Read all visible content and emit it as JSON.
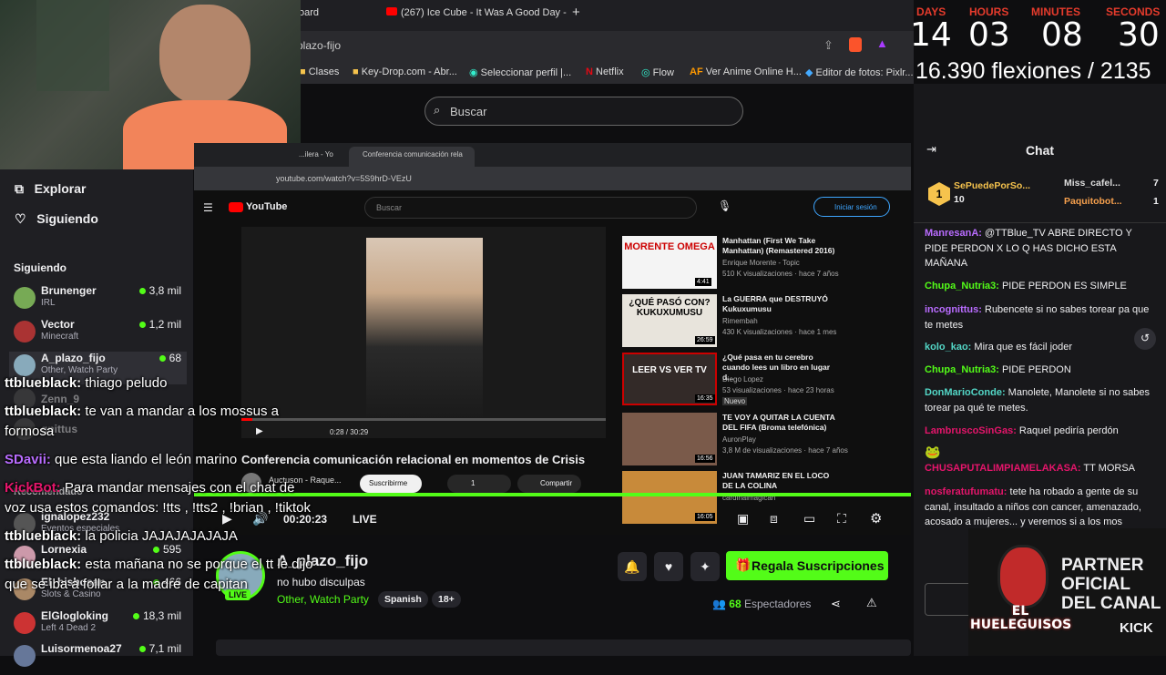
{
  "browser": {
    "tabs": [
      {
        "label": "oard"
      },
      {
        "label": "(267) Ice Cube - It Was A Good Day -"
      }
    ],
    "new_tab": "+",
    "url": "plazo-fijo",
    "bookmarks": [
      {
        "label": "Clases"
      },
      {
        "label": "Key-Drop.com - Abr..."
      },
      {
        "label": "Seleccionar perfil |..."
      },
      {
        "label": "Netflix"
      },
      {
        "label": "Flow"
      },
      {
        "label": "Ver Anime Online H..."
      },
      {
        "label": "Editor de fotos: Pixlr..."
      }
    ]
  },
  "search": {
    "placeholder": "Buscar"
  },
  "timer": {
    "labels": {
      "days": "DAYS",
      "hours": "HOURS",
      "minutes": "MINUTES",
      "seconds": "SECONDS"
    },
    "values": {
      "days": "14",
      "hours": "03",
      "minutes": "08",
      "seconds": "30"
    },
    "pushups": "16.390 flexiones / 2135"
  },
  "sidebar": {
    "explore": "Explorar",
    "following": "Siguiendo",
    "section": "Siguiendo",
    "recommended": "Recomendado",
    "channels": [
      {
        "name": "Brunenger",
        "category": "IRL",
        "viewers": "3,8 mil"
      },
      {
        "name": "Vector",
        "category": "Minecraft",
        "viewers": "1,2 mil"
      },
      {
        "name": "A_plazo_fijo",
        "category": "Other, Watch Party",
        "viewers": "68"
      },
      {
        "name": "Zenn_9",
        "category": "",
        "viewers": ""
      },
      {
        "name": "gnittus",
        "category": "",
        "viewers": ""
      }
    ],
    "rec_channels": [
      {
        "name": "ignalopez232",
        "category": "Eventos especiales",
        "viewers": ""
      },
      {
        "name": "Lornexia",
        "category": "",
        "viewers": "595"
      },
      {
        "name": "El_bishosan",
        "category": "Slots & Casino",
        "viewers": "466"
      },
      {
        "name": "ElGlogloking",
        "category": "Left 4 Dead 2",
        "viewers": "18,3 mil"
      },
      {
        "name": "Luisormenoa27",
        "category": "",
        "viewers": "7,1 mil"
      }
    ]
  },
  "youtube": {
    "tabs": [
      "...ilera - Yo",
      "Conferencia comunicación rela"
    ],
    "url": "youtube.com/watch?v=5S9hrD-VEzU",
    "logo": "YouTube",
    "search_placeholder": "Buscar",
    "signin": "Iniciar sesión",
    "time": "0:28 / 30:29",
    "video_title": "Conferencia comunicación relacional en momentos de Crisis",
    "channel": "Auctuson - Raque...",
    "subscribe": "Suscribirme",
    "likes": "1",
    "share": "Compartir",
    "recommendations": [
      {
        "title": "Manhattan (First We Take Manhattan) (Remastered 2016)",
        "channel": "Enrique Morente - Topic",
        "meta": "510 K visualizaciones · hace 7 años",
        "duration": "4:41",
        "thumb": "MORENTE OMEGA"
      },
      {
        "title": "La GUERRA que DESTRUYÓ Kukuxumusu",
        "channel": "Rimembah",
        "meta": "430 K visualizaciones · hace 1 mes",
        "duration": "26:59",
        "thumb": "¿QUÉ PASÓ CON? KUKUXUMUSU"
      },
      {
        "title": "¿Qué pasa en tu cerebro cuando lees un libro en lugar d...",
        "channel": "Diego Lopez",
        "meta": "53 visualizaciones · hace 23 horas",
        "duration": "16:35",
        "thumb": "LEER VS VER TV",
        "badge": "Nuevo"
      },
      {
        "title": "TE VOY A QUITAR LA CUENTA DEL FIFA (Broma telefónica)",
        "channel": "AuronPlay",
        "meta": "3,8 M de visualizaciones · hace 7 años",
        "duration": "16:56",
        "thumb": ""
      },
      {
        "title": "JUAN TAMARIZ EN EL LOCO DE LA COLINA",
        "channel": "cardinalmagican",
        "meta": "",
        "duration": "16:05",
        "thumb": ""
      }
    ]
  },
  "player": {
    "time": "00:20:23",
    "live": "LIVE"
  },
  "stream": {
    "name": "A_plazo_fijo",
    "title": "no hubo disculpas",
    "category": "Other, Watch Party",
    "tags": [
      "Spanish",
      "18+"
    ],
    "live_badge": "LIVE",
    "gift": "Regala Suscripciones",
    "viewers": "68",
    "viewers_label": "Espectadores"
  },
  "chat": {
    "title": "Chat",
    "leaderboard": [
      {
        "name": "SePuedePorSo...",
        "value": "10"
      },
      {
        "name": "Miss_cafel...",
        "value": "7"
      },
      {
        "name": "Paquitobot...",
        "value": "1"
      }
    ],
    "messages": [
      {
        "user": "ManresanA:",
        "text": "@TTBlue_TV ABRE DIRECTO Y PIDE PERDON X LO Q HAS DICHO ESTA MAÑANA",
        "color": "#b96cff"
      },
      {
        "user": "Chupa_Nutria3:",
        "text": "PIDE PERDON ES SIMPLE",
        "color": "#53fc18"
      },
      {
        "user": "incognittus:",
        "text": "Rubencete si no sabes torear pa que te metes",
        "color": "#b96cff"
      },
      {
        "user": "kolo_kao:",
        "text": "Mira que es fácil joder",
        "color": "#53d6c6"
      },
      {
        "user": "Chupa_Nutria3:",
        "text": "PIDE PERDON",
        "color": "#53fc18"
      },
      {
        "user": "DonMarioConde:",
        "text": "Manolete, Manolete si no sabes torear pa qué te metes.",
        "color": "#53d6c6"
      },
      {
        "user": "LambruscoSinGas:",
        "text": "Raquel pediría perdón",
        "color": "#e5156b"
      },
      {
        "user": "CHUSAPUTALIMPIAMELAKASA:",
        "text": "TT MORSA",
        "color": "#e5156b"
      },
      {
        "user": "nosferatufumatu:",
        "text": "tete ha robado a gente de su canal, insultado a niños con cancer, amenazado, acosado a mujeres... y veremos si a los mos",
        "color": "#e5156b"
      }
    ]
  },
  "overlay_chat": [
    {
      "user": "ttblueblack:",
      "text": "thiago peludo"
    },
    {
      "user": "ttblueblack:",
      "text": "te van a mandar a los mossus a"
    },
    {
      "user": "",
      "text": "formosa"
    },
    {
      "user": "SDavii:",
      "text": "que esta liando el león marino"
    },
    {
      "user": "KickBot:",
      "text": "Para mandar mensajes con el chat de"
    },
    {
      "user": "",
      "text": "voz usa estos comandos: !tts , !tts2 , !brian , !tiktok"
    },
    {
      "user": "ttblueblack:",
      "text": "la policia JAJAJAJAJAJA"
    },
    {
      "user": "ttblueblack:",
      "text": "esta mañana no se porque el tt le dijo"
    },
    {
      "user": "",
      "text": "que se iba a follar a la madre de capitan"
    }
  ],
  "partner": {
    "brand": "EL HUELEGUISOS",
    "line1": "PARTNER",
    "line2": "OFICIAL",
    "line3": "DEL CANAL",
    "platform": "KICK"
  },
  "colors": {
    "accent": "#53fc18",
    "timer_label": "#e53b2c",
    "bg": "#0e0e10"
  }
}
